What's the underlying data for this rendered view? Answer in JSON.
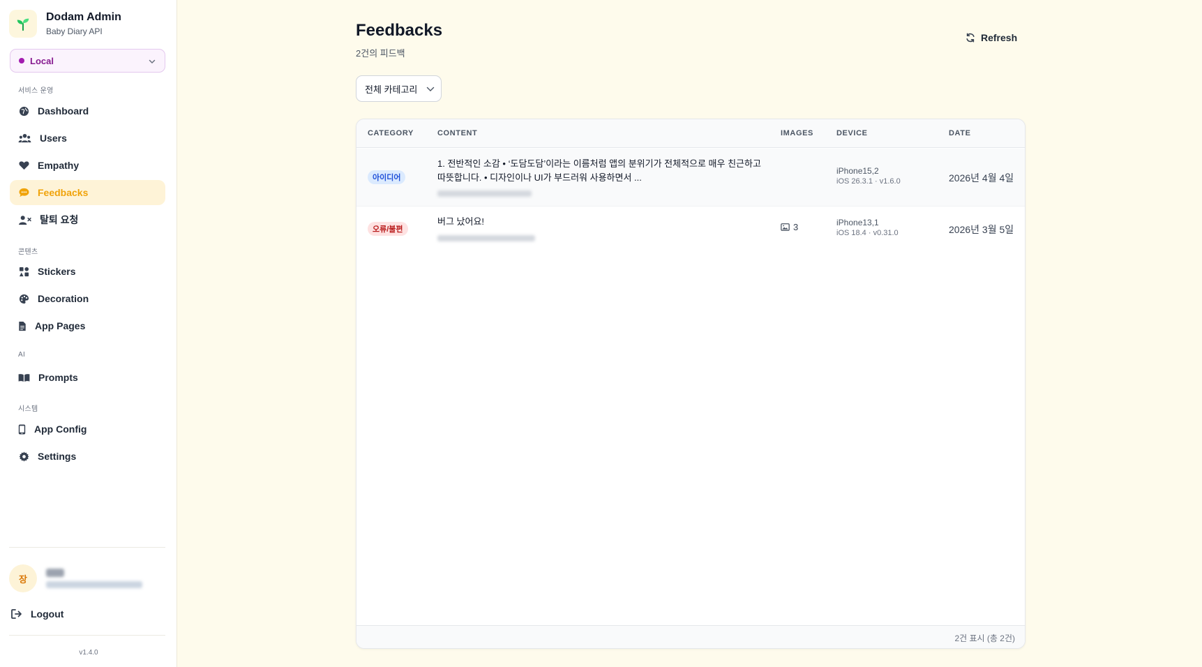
{
  "brand": {
    "title": "Dodam Admin",
    "subtitle": "Baby Diary API"
  },
  "env": {
    "selected": "Local",
    "color": "#a21caf"
  },
  "sidebar": {
    "sections": [
      "서비스 운영",
      "콘텐츠",
      "AI",
      "시스템"
    ],
    "items": [
      {
        "label": "Dashboard",
        "icon": "globe-icon"
      },
      {
        "label": "Users",
        "icon": "users-icon"
      },
      {
        "label": "Empathy",
        "icon": "heart-icon"
      },
      {
        "label": "Feedbacks",
        "icon": "chat-icon",
        "active": true
      },
      {
        "label": "탈퇴 요청",
        "icon": "user-remove-icon"
      },
      {
        "label": "Stickers",
        "icon": "shapes-icon"
      },
      {
        "label": "Decoration",
        "icon": "palette-icon"
      },
      {
        "label": "App Pages",
        "icon": "file-icon"
      },
      {
        "label": "Prompts",
        "icon": "book-icon"
      },
      {
        "label": "App Config",
        "icon": "phone-icon"
      },
      {
        "label": "Settings",
        "icon": "gear-icon"
      }
    ],
    "user_initial": "장",
    "logout_label": "Logout",
    "version": "v1.4.0"
  },
  "page": {
    "title": "Feedbacks",
    "subtitle": "2건의 피드백",
    "refresh_label": "Refresh",
    "filter_selected": "전체 카테고리"
  },
  "table": {
    "headers": [
      "CATEGORY",
      "CONTENT",
      "IMAGES",
      "DEVICE",
      "DATE"
    ],
    "rows": [
      {
        "category": "아이디어",
        "content": "1. 전반적인 소감 • ‘도담도담’이라는 이름처럼 앱의 분위기가 전체적으로 매우 친근하고 따뜻합니다. • 디자인이나 UI가 부드러워 사용하면서 ...",
        "images": "",
        "device_model": "iPhone15,2",
        "device_os": "iOS 26.3.1 · v1.6.0",
        "date": "2026년 4월 4일"
      },
      {
        "category": "오류/불편",
        "content": "버그 났어요!",
        "images": "3",
        "device_model": "iPhone13,1",
        "device_os": "iOS 18.4 · v0.31.0",
        "date": "2026년 3월 5일"
      }
    ],
    "footer": "2건 표시 (총 2건)"
  },
  "colors": {
    "accent": "#f0a30a",
    "background": "#fefbec",
    "idea_badge": "#1d4ed8",
    "bug_badge": "#b91c1c"
  }
}
